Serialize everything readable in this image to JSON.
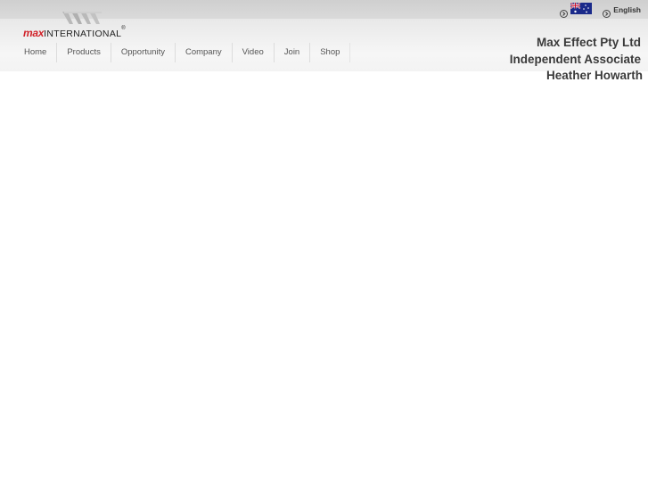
{
  "brand": {
    "logo_max": "max",
    "logo_international": "INTERNATIONAL",
    "logo_registered": "®"
  },
  "top_links": {
    "language_label": "English",
    "country_flag_icon": "australia-flag-icon",
    "arrow_icon": "circle-arrow-right-icon"
  },
  "nav": {
    "items": [
      {
        "label": "Home"
      },
      {
        "label": "Products"
      },
      {
        "label": "Opportunity"
      },
      {
        "label": "Company"
      },
      {
        "label": "Video"
      },
      {
        "label": "Join"
      },
      {
        "label": "Shop"
      }
    ]
  },
  "associate": {
    "company": "Max Effect Pty Ltd",
    "role": "Independent Associate",
    "name": "Heather Howarth"
  },
  "colors": {
    "brand_red": "#d1232a",
    "text_dark": "#3a3a3a",
    "nav_text": "#555555"
  }
}
